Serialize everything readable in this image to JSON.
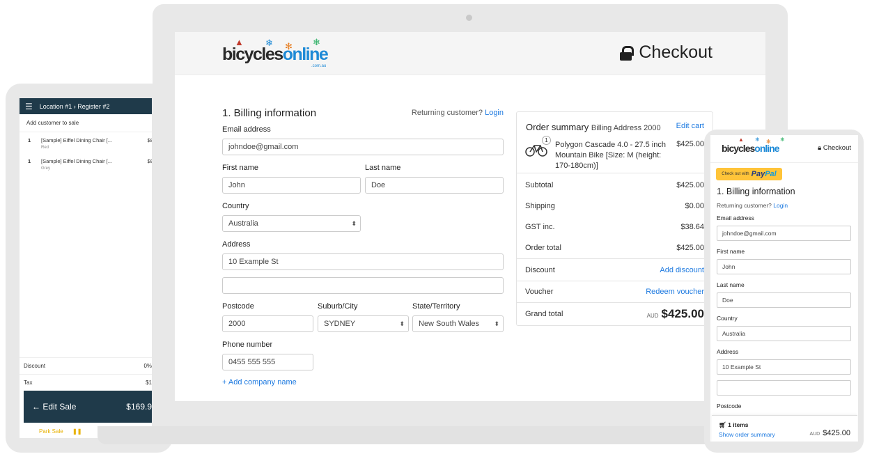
{
  "pos": {
    "breadcrumb": "Location #1 › Register #2",
    "add_customer": "Add customer to sale",
    "items": [
      {
        "qty": "1",
        "name": "[Sample] Eiffel Dining Chair [...",
        "variant": "Red",
        "price": "$8"
      },
      {
        "qty": "1",
        "name": "[Sample] Eiffel Dining Chair [...",
        "variant": "Grey",
        "price": "$8"
      }
    ],
    "discount_label": "Discount",
    "discount_value": "0%",
    "tax_label": "Tax",
    "tax_value": "$1",
    "edit_sale": "← Edit Sale",
    "edit_total": "$169.9",
    "park_sale": "Park Sale",
    "pause_icon": "❚❚"
  },
  "checkout": {
    "logo_prefix": "bicycles",
    "logo_suffix": "online",
    "logo_sub": ".com.au",
    "title": "Checkout",
    "section_title": "1. Billing information",
    "returning_text": "Returning customer?",
    "login_link": "Login",
    "email_label": "Email address",
    "email_value": "johndoe@gmail.com",
    "first_name_label": "First name",
    "first_name_value": "John",
    "last_name_label": "Last name",
    "last_name_value": "Doe",
    "country_label": "Country",
    "country_value": "Australia",
    "address_label": "Address",
    "address_value": "10 Example St",
    "address2_value": "",
    "postcode_label": "Postcode",
    "postcode_value": "2000",
    "suburb_label": "Suburb/City",
    "suburb_value": "SYDNEY",
    "state_label": "State/Territory",
    "state_value": "New South Wales",
    "phone_label": "Phone number",
    "phone_value": "0455 555 555",
    "add_company": "Add company name"
  },
  "summary": {
    "title": "Order summary",
    "subtitle": "Billing Address 2000",
    "edit_cart": "Edit cart",
    "badge": "1",
    "product_name": "Polygon Cascade 4.0 - 27.5 inch Mountain Bike [Size: M (height: 170-180cm)]",
    "product_price": "$425.00",
    "rows": [
      {
        "label": "Subtotal",
        "value": "$425.00"
      },
      {
        "label": "Shipping",
        "value": "$0.00"
      },
      {
        "label": "GST inc.",
        "value": "$38.64"
      },
      {
        "label": "Order total",
        "value": "$425.00"
      }
    ],
    "discount_label": "Discount",
    "discount_link": "Add discount",
    "voucher_label": "Voucher",
    "voucher_link": "Redeem voucher",
    "grand_label": "Grand total",
    "currency": "AUD",
    "grand_value": "$425.00"
  },
  "mobile": {
    "logo_prefix": "bicycles",
    "logo_suffix": "online",
    "checkout": "Checkout",
    "paypal_prefix": "Check out with",
    "paypal_pay": "Pay",
    "paypal_pal": "Pal",
    "section_title": "1. Billing information",
    "returning_text": "Returning customer?",
    "login_link": "Login",
    "email_label": "Email address",
    "email_value": "johndoe@gmail.com",
    "first_name_label": "First name",
    "first_name_value": "John",
    "last_name_label": "Last name",
    "last_name_value": "Doe",
    "country_label": "Country",
    "country_value": "Australia",
    "address_label": "Address",
    "address_value": "10 Example St",
    "postcode_label": "Postcode",
    "items_count": "1 items",
    "show_summary": "Show order summary",
    "currency": "AUD",
    "total": "$425.00"
  },
  "colors": {
    "link": "#1e7ae0",
    "pos_header": "#1f3a4a",
    "brand_blue": "#1e8ad6",
    "paypal_yellow": "#ffc439"
  }
}
